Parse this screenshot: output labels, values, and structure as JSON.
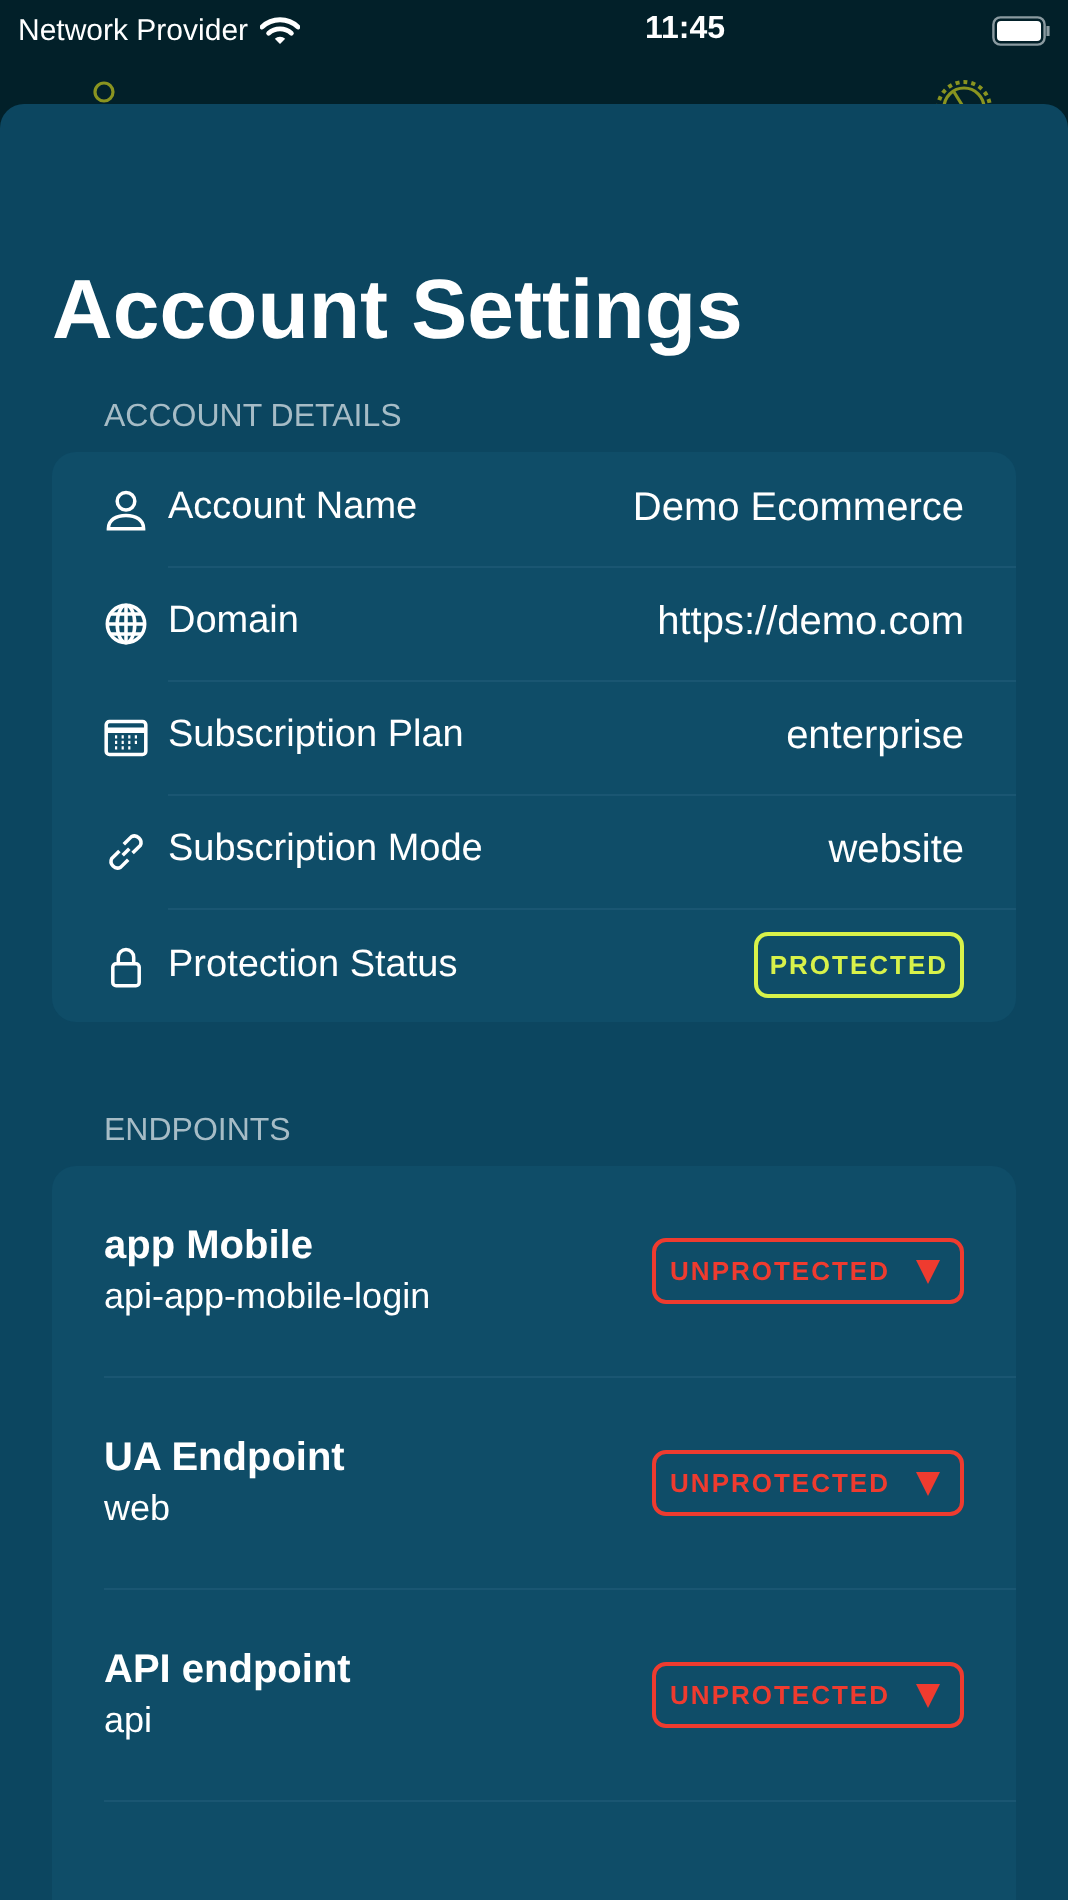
{
  "status_bar": {
    "carrier": "Network Provider",
    "time": "11:45"
  },
  "title": "Account Settings",
  "account_details": {
    "header": "ACCOUNT DETAILS",
    "rows": [
      {
        "label": "Account Name",
        "value": "Demo Ecommerce",
        "kind": "text"
      },
      {
        "label": "Domain",
        "value": "https://demo.com",
        "kind": "text"
      },
      {
        "label": "Subscription Plan",
        "value": "enterprise",
        "kind": "text"
      },
      {
        "label": "Subscription Mode",
        "value": "website",
        "kind": "text"
      },
      {
        "label": "Protection Status",
        "value": "PROTECTED",
        "kind": "badge",
        "protected": true
      }
    ]
  },
  "endpoints": {
    "header": "ENDPOINTS",
    "items": [
      {
        "name": "app Mobile",
        "detail": "api-app-mobile-login",
        "badge": "UNPROTECTED",
        "protected": false
      },
      {
        "name": "UA Endpoint",
        "detail": "web",
        "badge": "UNPROTECTED",
        "protected": false
      },
      {
        "name": "API endpoint",
        "detail": "api",
        "badge": "UNPROTECTED",
        "protected": false
      }
    ]
  }
}
